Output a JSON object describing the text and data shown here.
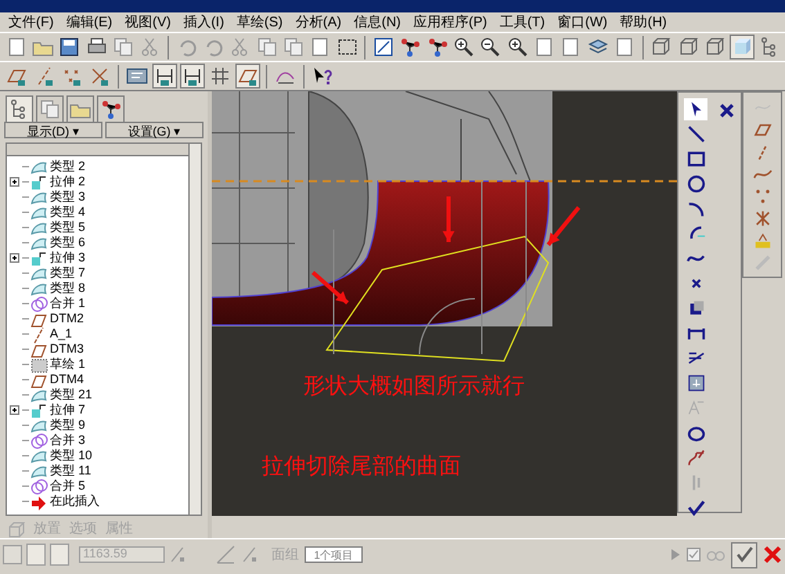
{
  "menu": [
    "文件(F)",
    "编辑(E)",
    "视图(V)",
    "插入(I)",
    "草绘(S)",
    "分析(A)",
    "信息(N)",
    "应用程序(P)",
    "工具(T)",
    "窗口(W)",
    "帮助(H)"
  ],
  "panel": {
    "buttons": [
      "显示(D) ▾",
      "设置(G) ▾"
    ],
    "tree": [
      {
        "label": "类型 2",
        "kind": "style",
        "expandable": false
      },
      {
        "label": "拉伸 2",
        "kind": "extrude",
        "expandable": true
      },
      {
        "label": "类型 3",
        "kind": "style",
        "expandable": false
      },
      {
        "label": "类型 4",
        "kind": "style",
        "expandable": false
      },
      {
        "label": "类型 5",
        "kind": "style",
        "expandable": false
      },
      {
        "label": "类型 6",
        "kind": "style",
        "expandable": false
      },
      {
        "label": "拉伸 3",
        "kind": "extrude",
        "expandable": true
      },
      {
        "label": "类型 7",
        "kind": "style",
        "expandable": false
      },
      {
        "label": "类型 8",
        "kind": "style",
        "expandable": false
      },
      {
        "label": "合并 1",
        "kind": "merge",
        "expandable": false
      },
      {
        "label": "DTM2",
        "kind": "plane",
        "expandable": false
      },
      {
        "label": "A_1",
        "kind": "axis",
        "expandable": false
      },
      {
        "label": "DTM3",
        "kind": "plane",
        "expandable": false
      },
      {
        "label": "草绘 1",
        "kind": "sketch",
        "expandable": false
      },
      {
        "label": "DTM4",
        "kind": "plane",
        "expandable": false
      },
      {
        "label": "类型 21",
        "kind": "style",
        "expandable": false
      },
      {
        "label": "拉伸 7",
        "kind": "extrude",
        "expandable": true
      },
      {
        "label": "类型 9",
        "kind": "style",
        "expandable": false
      },
      {
        "label": "合并 3",
        "kind": "merge",
        "expandable": false
      },
      {
        "label": "类型 10",
        "kind": "style",
        "expandable": false
      },
      {
        "label": "类型 11",
        "kind": "style",
        "expandable": false
      },
      {
        "label": "合并 5",
        "kind": "merge",
        "expandable": false
      },
      {
        "label": "在此插入",
        "kind": "insert",
        "expandable": false
      }
    ]
  },
  "dashboard": {
    "tabs": [
      "放置",
      "选项",
      "属性"
    ],
    "depth": "1163.59"
  },
  "viewport": {
    "notes": [
      "形状大概如图所示就行",
      "拉伸切除尾部的曲面"
    ]
  },
  "bottom": {
    "label": "面组",
    "field": "1个项目"
  }
}
